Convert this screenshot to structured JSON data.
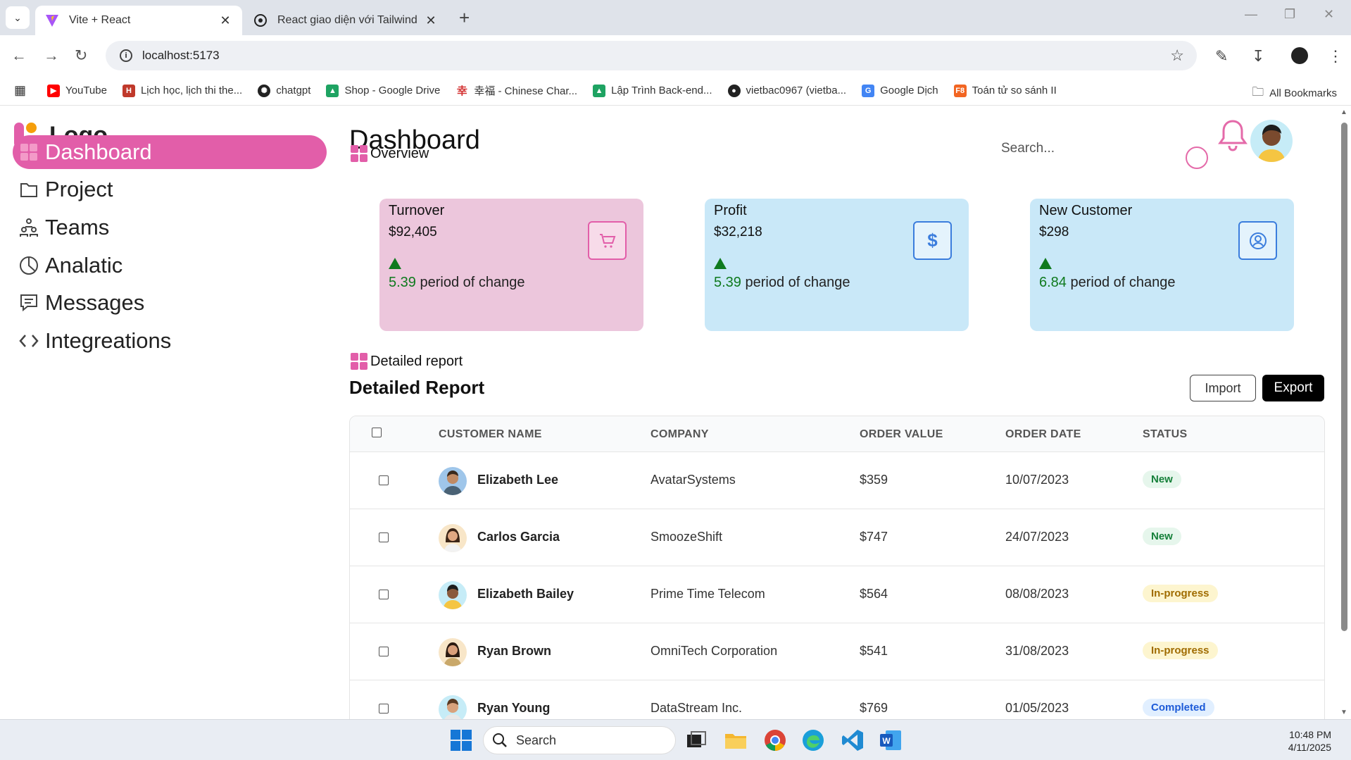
{
  "browser": {
    "tabs": [
      {
        "title": "Vite + React",
        "active": true
      },
      {
        "title": "React giao diện với Tailwind",
        "active": false
      }
    ],
    "url": "localhost:5173",
    "bookmarks": [
      {
        "label": "YouTube",
        "icon": "youtube-icon",
        "color": "#ff0000"
      },
      {
        "label": "Lịch học, lịch thi the...",
        "icon": "school-icon",
        "color": "#c0392b"
      },
      {
        "label": "chatgpt",
        "icon": "chatgpt-icon",
        "color": "#222222"
      },
      {
        "label": "Shop - Google Drive",
        "icon": "drive-icon",
        "color": "#1ea362"
      },
      {
        "label": "幸福 - Chinese Char...",
        "icon": "chinese-char-icon",
        "color": "#d32f2f"
      },
      {
        "label": "Lập Trình Back-end...",
        "icon": "drive-icon",
        "color": "#1ea362"
      },
      {
        "label": "vietbac0967 (vietba...",
        "icon": "github-icon",
        "color": "#222222"
      },
      {
        "label": "Google Dịch",
        "icon": "translate-icon",
        "color": "#4285f4"
      },
      {
        "label": "Toán tử so sánh II",
        "icon": "f8-icon",
        "color": "#f26522"
      }
    ],
    "all_bookmarks": "All Bookmarks"
  },
  "sidebar": {
    "logo": "Logo",
    "items": [
      {
        "label": "Dashboard",
        "icon": "dashboard-icon",
        "active": true
      },
      {
        "label": "Project",
        "icon": "folder-icon",
        "active": false
      },
      {
        "label": "Teams",
        "icon": "teams-icon",
        "active": false
      },
      {
        "label": "Analatic",
        "icon": "pie-chart-icon",
        "active": false
      },
      {
        "label": "Messages",
        "icon": "message-icon",
        "active": false
      },
      {
        "label": "Integreations",
        "icon": "code-icon",
        "active": false
      }
    ]
  },
  "header": {
    "title": "Dashboard",
    "search_placeholder": "Search..."
  },
  "overview": {
    "label": "Overview",
    "cards": [
      {
        "title": "Turnover",
        "value": "$92,405",
        "change": "5.39",
        "change_text": "period of change",
        "icon": "cart-icon",
        "bg": "#ecc6dc",
        "accent": "#e25ea9"
      },
      {
        "title": "Profit",
        "value": "$32,218",
        "change": "5.39",
        "change_text": "period of change",
        "icon": "dollar-icon",
        "bg": "#c9e8f8",
        "accent": "#3b7ddd"
      },
      {
        "title": "New Customer",
        "value": "$298",
        "change": "6.84",
        "change_text": "period of change",
        "icon": "user-icon",
        "bg": "#c9e8f8",
        "accent": "#3b7ddd"
      }
    ]
  },
  "report": {
    "section_label": "Detailed report",
    "title": "Detailed Report",
    "import_label": "Import",
    "export_label": "Export",
    "columns": [
      "CUSTOMER NAME",
      "COMPANY",
      "ORDER VALUE",
      "ORDER DATE",
      "STATUS"
    ],
    "rows": [
      {
        "name": "Elizabeth Lee",
        "company": "AvatarSystems",
        "value": "$359",
        "date": "10/07/2023",
        "status": "New",
        "status_type": "new"
      },
      {
        "name": "Carlos Garcia",
        "company": "SmoozeShift",
        "value": "$747",
        "date": "24/07/2023",
        "status": "New",
        "status_type": "new"
      },
      {
        "name": "Elizabeth Bailey",
        "company": "Prime Time Telecom",
        "value": "$564",
        "date": "08/08/2023",
        "status": "In-progress",
        "status_type": "prog"
      },
      {
        "name": "Ryan Brown",
        "company": "OmniTech Corporation",
        "value": "$541",
        "date": "31/08/2023",
        "status": "In-progress",
        "status_type": "prog"
      },
      {
        "name": "Ryan Young",
        "company": "DataStream Inc.",
        "value": "$769",
        "date": "01/05/2023",
        "status": "Completed",
        "status_type": "done"
      }
    ]
  },
  "taskbar": {
    "search_label": "Search",
    "time": "10:48 PM",
    "date": "4/11/2025"
  }
}
